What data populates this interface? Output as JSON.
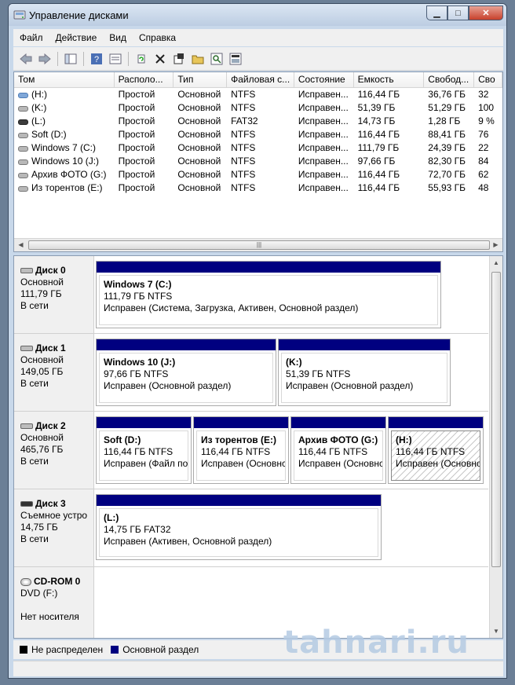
{
  "window": {
    "title": "Управление дисками"
  },
  "menu": [
    "Файл",
    "Действие",
    "Вид",
    "Справка"
  ],
  "toolbar": {
    "icons": [
      "back-arrow-icon",
      "forward-arrow-icon",
      "console-tree-icon",
      "help-icon",
      "properties-icon",
      "refresh-icon",
      "delete-icon",
      "settings-icon",
      "open-folder-icon",
      "search-icon",
      "export-icon"
    ]
  },
  "volumes": {
    "headers": [
      "Том",
      "Располо...",
      "Тип",
      "Файловая с...",
      "Состояние",
      "Емкость",
      "Свобод...",
      "Сво"
    ],
    "rows": [
      [
        "(H:)",
        "Простой",
        "Основной",
        "NTFS",
        "Исправен...",
        "116,44 ГБ",
        "36,76 ГБ",
        "32"
      ],
      [
        "(K:)",
        "Простой",
        "Основной",
        "NTFS",
        "Исправен...",
        "51,39 ГБ",
        "51,29 ГБ",
        "100"
      ],
      [
        "(L:)",
        "Простой",
        "Основной",
        "FAT32",
        "Исправен...",
        "14,73 ГБ",
        "1,28 ГБ",
        "9 %"
      ],
      [
        "Soft (D:)",
        "Простой",
        "Основной",
        "NTFS",
        "Исправен...",
        "116,44 ГБ",
        "88,41 ГБ",
        "76"
      ],
      [
        "Windows 7 (C:)",
        "Простой",
        "Основной",
        "NTFS",
        "Исправен...",
        "111,79 ГБ",
        "24,39 ГБ",
        "22"
      ],
      [
        "Windows 10 (J:)",
        "Простой",
        "Основной",
        "NTFS",
        "Исправен...",
        "97,66 ГБ",
        "82,30 ГБ",
        "84"
      ],
      [
        "Архив ФОТО (G:)",
        "Простой",
        "Основной",
        "NTFS",
        "Исправен...",
        "116,44 ГБ",
        "72,70 ГБ",
        "62"
      ],
      [
        "Из торентов (E:)",
        "Простой",
        "Основной",
        "NTFS",
        "Исправен...",
        "116,44 ГБ",
        "55,93 ГБ",
        "48"
      ]
    ]
  },
  "disks": [
    {
      "name": "Диск 0",
      "type": "Основной",
      "size": "111,79 ГБ",
      "status": "В сети",
      "partitions": [
        {
          "name": "Windows 7  (C:)",
          "size": "111,79 ГБ NTFS",
          "status": "Исправен (Система, Загрузка, Активен, Основной раздел)"
        }
      ]
    },
    {
      "name": "Диск 1",
      "type": "Основной",
      "size": "149,05 ГБ",
      "status": "В сети",
      "partitions": [
        {
          "name": "Windows 10  (J:)",
          "size": "97,66 ГБ NTFS",
          "status": "Исправен (Основной раздел)"
        },
        {
          "name": "(K:)",
          "size": "51,39 ГБ NTFS",
          "status": "Исправен (Основной раздел)"
        }
      ]
    },
    {
      "name": "Диск 2",
      "type": "Основной",
      "size": "465,76 ГБ",
      "status": "В сети",
      "partitions": [
        {
          "name": "Soft  (D:)",
          "size": "116,44 ГБ NTFS",
          "status": "Исправен (Файл по,"
        },
        {
          "name": "Из торентов  (E:)",
          "size": "116,44 ГБ NTFS",
          "status": "Исправен (Основнс"
        },
        {
          "name": "Архив ФОТО  (G:)",
          "size": "116,44 ГБ NTFS",
          "status": "Исправен (Основнс"
        },
        {
          "name": "(H:)",
          "size": "116,44 ГБ NTFS",
          "status": "Исправен (Основно"
        }
      ]
    },
    {
      "name": "Диск 3",
      "type": "Съемное устро",
      "size": "14,75 ГБ",
      "status": "В сети",
      "partitions": [
        {
          "name": "(L:)",
          "size": "14,75 ГБ FAT32",
          "status": "Исправен (Активен, Основной раздел)"
        }
      ]
    },
    {
      "name": "CD-ROM 0",
      "type": "DVD (F:)",
      "size": "",
      "status": "Нет носителя",
      "partitions": []
    }
  ],
  "legend": [
    {
      "label": "Не распределен",
      "color": "#000000"
    },
    {
      "label": "Основной раздел",
      "color": "#000080"
    }
  ],
  "watermark": "tahnari.ru"
}
